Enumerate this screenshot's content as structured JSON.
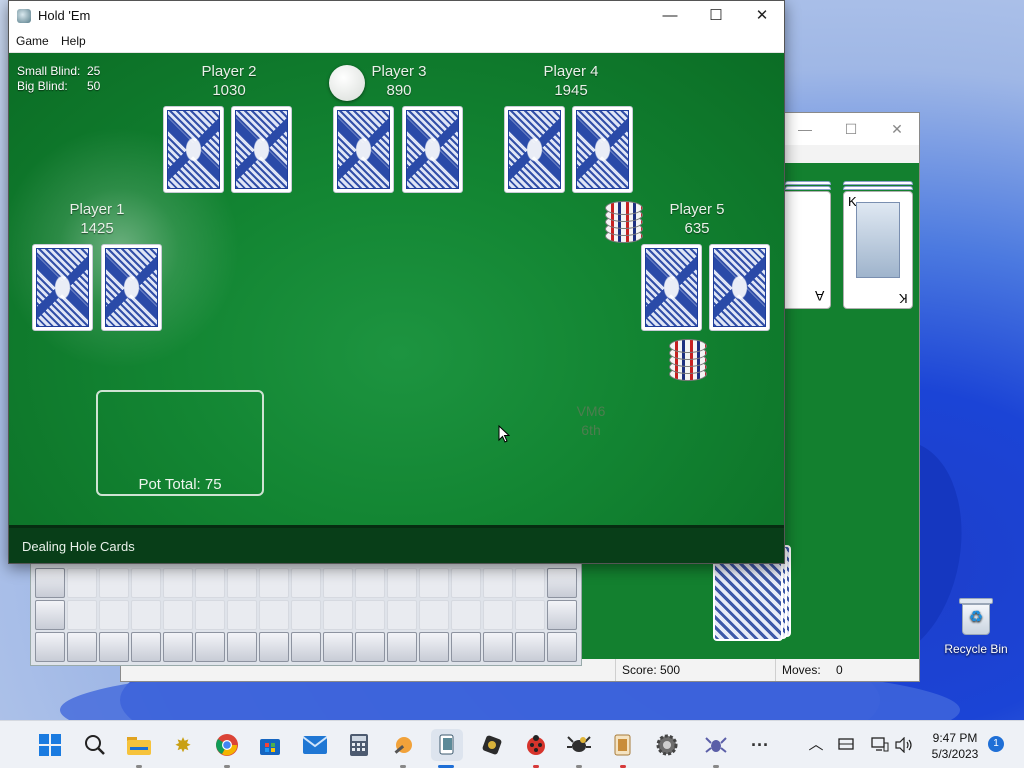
{
  "desktop": {
    "recycle_bin_label": "Recycle Bin"
  },
  "solitaire_window": {
    "score_label": "Score: 500",
    "moves_label": "Moves:",
    "moves_value": "0",
    "card_rank_top": "K",
    "card_rank_ace": "A",
    "card_rank_king_bottom": "K"
  },
  "holdem_window": {
    "title": "Hold 'Em",
    "menu": [
      "Game",
      "Help"
    ],
    "blinds": {
      "small_label": "Small Blind:",
      "small_value": "25",
      "big_label": "Big Blind:",
      "big_value": "50"
    },
    "players": [
      {
        "name": "Player 1",
        "chips": "1425"
      },
      {
        "name": "Player 2",
        "chips": "1030"
      },
      {
        "name": "Player 3",
        "chips": "890"
      },
      {
        "name": "Player 4",
        "chips": "1945"
      },
      {
        "name": "Player 5",
        "chips": "635"
      }
    ],
    "pot_total": "Pot Total: 75",
    "watermark": [
      "VM6",
      "6th"
    ],
    "status": "Dealing Hole Cards"
  },
  "taskbar": {
    "apps": [
      "start-icon",
      "search-icon",
      "file-explorer-icon",
      "bee-app-icon",
      "chrome-icon",
      "store-icon",
      "mail-icon",
      "calculator-icon",
      "paint-icon",
      "holdem-icon",
      "game-icon",
      "ladybug-icon",
      "spider-icon",
      "solitaire-icon",
      "settings-gear-icon",
      "spider-solitaire-icon",
      "more-icon"
    ],
    "time": "9:47 PM",
    "date": "5/3/2023",
    "notification_count": "1"
  }
}
